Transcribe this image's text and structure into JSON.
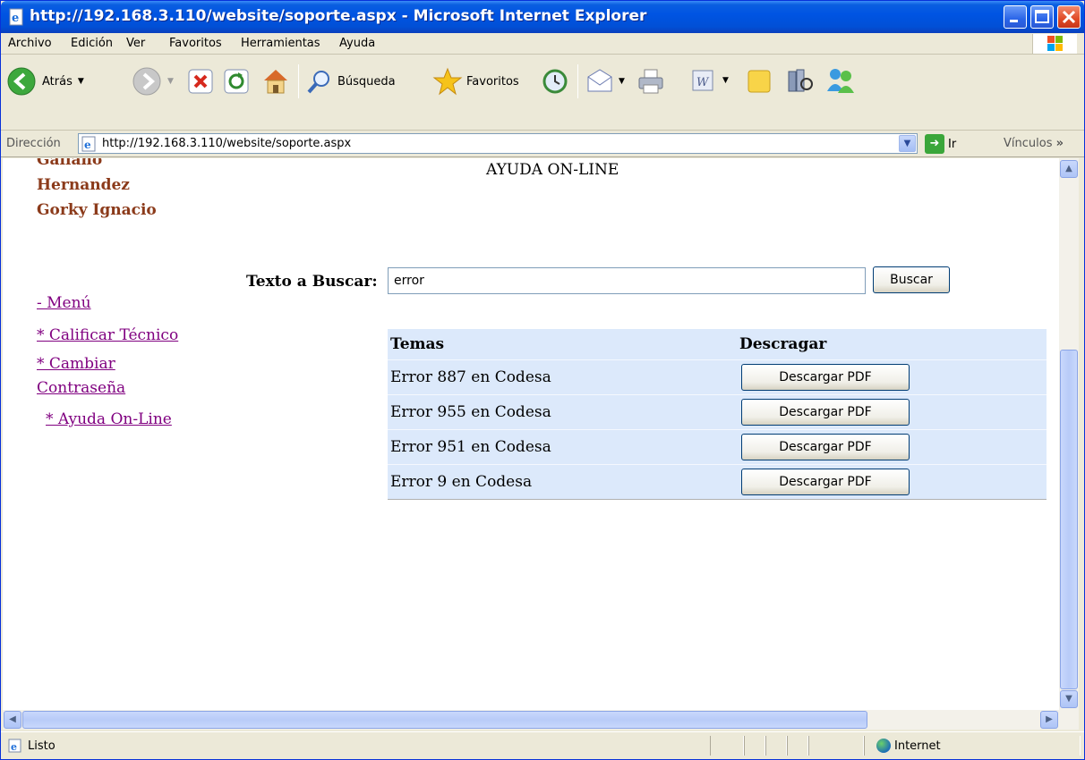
{
  "window": {
    "title": "http://192.168.3.110/website/soporte.aspx - Microsoft Internet Explorer"
  },
  "menu": [
    "Archivo",
    "Edición",
    "Ver",
    "Favoritos",
    "Herramientas",
    "Ayuda"
  ],
  "toolbar": {
    "back_label": "Atrás",
    "search_label": "Búsqueda",
    "favorites_label": "Favoritos"
  },
  "address": {
    "label": "Dirección",
    "url": "http://192.168.3.110/website/soporte.aspx",
    "go_label": "Ir",
    "links_label": "Vínculos"
  },
  "page": {
    "user_name_lines": [
      "Galiano",
      "Hernandez",
      "Gorky Ignacio"
    ],
    "heading": "AYUDA ON-LINE",
    "search": {
      "label": "Texto a Buscar:",
      "value": "error",
      "button": "Buscar"
    },
    "sidebar": {
      "menu_link": "- Menú",
      "rate_link": "* Calificar Técnico",
      "password_link_line1": "* Cambiar",
      "password_link_line2": "Contraseña",
      "help_link": "* Ayuda On-Line"
    },
    "results": {
      "headers": [
        "Temas",
        "Descragar"
      ],
      "rows": [
        {
          "topic": "Error 887 en Codesa",
          "button": "Descargar PDF"
        },
        {
          "topic": "Error 955 en Codesa",
          "button": "Descargar PDF"
        },
        {
          "topic": "Error 951 en Codesa",
          "button": "Descargar PDF"
        },
        {
          "topic": "Error 9 en Codesa",
          "button": "Descargar PDF"
        }
      ]
    }
  },
  "status": {
    "text": "Listo",
    "zone": "Internet"
  },
  "colors": {
    "titlebar": "#0054e3",
    "name_text": "#8b3a1a",
    "visited_link": "#800080",
    "results_bg": "#dce9fb"
  }
}
